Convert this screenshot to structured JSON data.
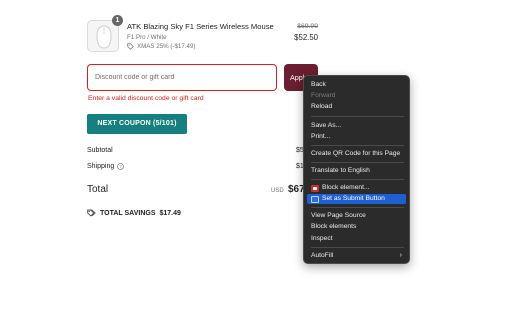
{
  "product": {
    "quantity": "1",
    "name": "ATK Blazing Sky F1 Series Wireless Mouse",
    "variant": "F1 Pro / White",
    "discount_label": "XMAS 25% (-$17.49)",
    "original_price": "$69.99",
    "price": "$52.50",
    "icons": [
      "mouse-product-image",
      "tag-icon"
    ]
  },
  "discount": {
    "placeholder": "Discount code or gift card",
    "value": "",
    "apply_label": "Apply",
    "error": "Enter a valid discount code or gift card"
  },
  "coupon_button": "NEXT COUPON (5/101)",
  "summary": {
    "subtotal_label": "Subtotal",
    "subtotal_value": "$5",
    "shipping_label": "Shipping",
    "shipping_value": "$1",
    "total_label": "Total",
    "currency": "USD",
    "total_value": "$67",
    "savings_label": "TOTAL SAVINGS",
    "savings_value": "$17.49"
  },
  "context_menu": {
    "items": [
      {
        "label": "Back"
      },
      {
        "label": "Forward",
        "disabled": true
      },
      {
        "label": "Reload"
      },
      {
        "label": "Save As..."
      },
      {
        "label": "Print..."
      },
      {
        "label": "Create QR Code for this Page"
      },
      {
        "label": "Translate to English"
      },
      {
        "label": "Block element..."
      },
      {
        "label": "Set as Submit Button",
        "highlighted": true
      },
      {
        "label": "View Page Source"
      },
      {
        "label": "Block elements"
      },
      {
        "label": "Inspect"
      },
      {
        "label": "AutoFill",
        "submenu": true
      }
    ]
  },
  "colors": {
    "accent": "#6b1e2f",
    "error": "#d91e18",
    "coupon_teal": "#167f7f",
    "menu_bg": "#2b2b2b",
    "menu_highlight": "#1e5fd2"
  }
}
